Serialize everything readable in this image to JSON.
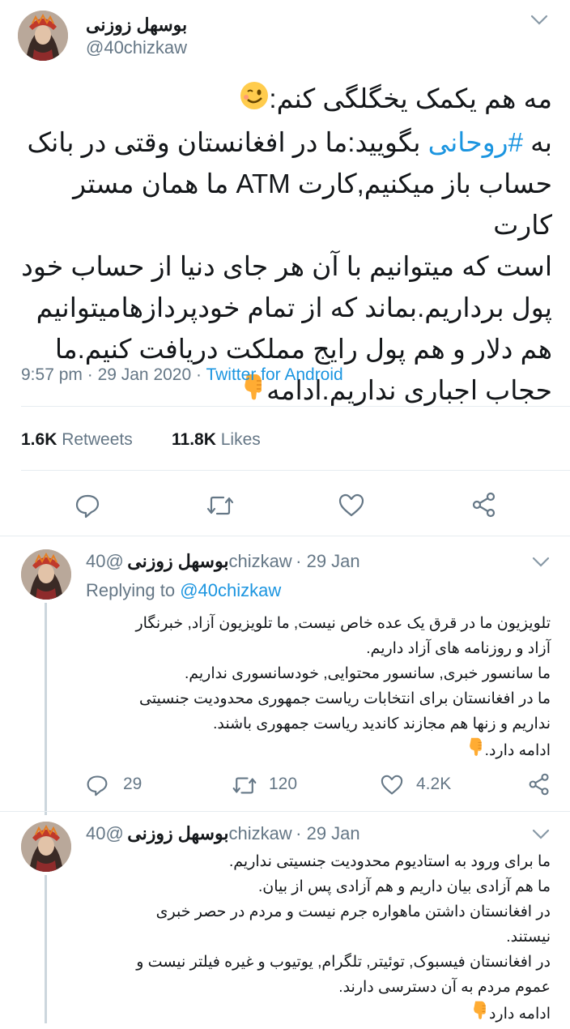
{
  "main_tweet": {
    "user_name": "بوسهل زوزنی",
    "handle": "@40chizkaw",
    "lines": [
      "مه هم یکمک یخگلگی کنم:",
      "بگویید:ما در افغانستان وقتی در بانک",
      "حساب باز میکنیم,کارت ATM ما همان مستر کارت",
      "است که میتوانیم با آن هر جای دنیا از حساب خود",
      "پول برداریم.بماند که از تمام خودپردازهامیتوانیم",
      "هم دلار و هم پول رایج مملکت دریافت کنیم.ما",
      "حجاب اجباری نداریم.ادامه"
    ],
    "hashtag": "#روحانی",
    "line2_prefix": "به",
    "time": "9:57 pm",
    "date": "29 Jan 2020",
    "source": "Twitter for Android",
    "retweets_count": "1.6K",
    "retweets_label": "Retweets",
    "likes_count": "11.8K",
    "likes_label": "Likes"
  },
  "replies": [
    {
      "user_name": "بوسهل زوزنی",
      "handle": "@40chizkaw",
      "date": "· 29 Jan",
      "replying_prefix": "Replying to",
      "replying_to": "@40chizkaw",
      "lines": [
        "تلویزیون ما در قرق یک عده خاص نیست, ما تلویزیون آزاد, خبرنگار",
        "آزاد و روزنامه های آزاد داریم.",
        "ما سانسور خبری, سانسور محتوایی, خودسانسوری نداریم.",
        "ما در افغانستان برای انتخابات ریاست جمهوری محدودیت جنسیتی",
        "نداریم و زنها هم مجازند کاندید ریاست جمهوری باشند.",
        "ادامه دارد."
      ],
      "reply_count": "29",
      "retweet_count": "120",
      "like_count": "4.2K"
    },
    {
      "user_name": "بوسهل زوزنی",
      "handle": "@40chizkaw",
      "date": "· 29 Jan",
      "lines": [
        "ما برای ورود به استادیوم محدودیت جنسیتی نداریم.",
        "ما هم آزادی بیان داریم و هم آزادی پس از بیان.",
        "در افغانستان داشتن ماهواره جرم نیست و مردم در حصر خبری",
        "نیستند.",
        "در افغانستان فیسبوک, توئیتر, تلگرام, یوتیوب و غیره فیلتر نیست و",
        "عموم مردم به آن دسترسی دارند.",
        "ادامه دارد"
      ]
    }
  ],
  "icons": {
    "reply": "reply-icon",
    "retweet": "retweet-icon",
    "like": "heart-icon",
    "share": "share-icon",
    "chevron": "chevron-down-icon",
    "winking_emoji": "winking-face-emoji",
    "pointing_down_emoji": "pointing-down-emoji"
  },
  "colors": {
    "accent": "#1b95e0",
    "secondary_text": "#657786",
    "divider": "#e6ecf0"
  }
}
